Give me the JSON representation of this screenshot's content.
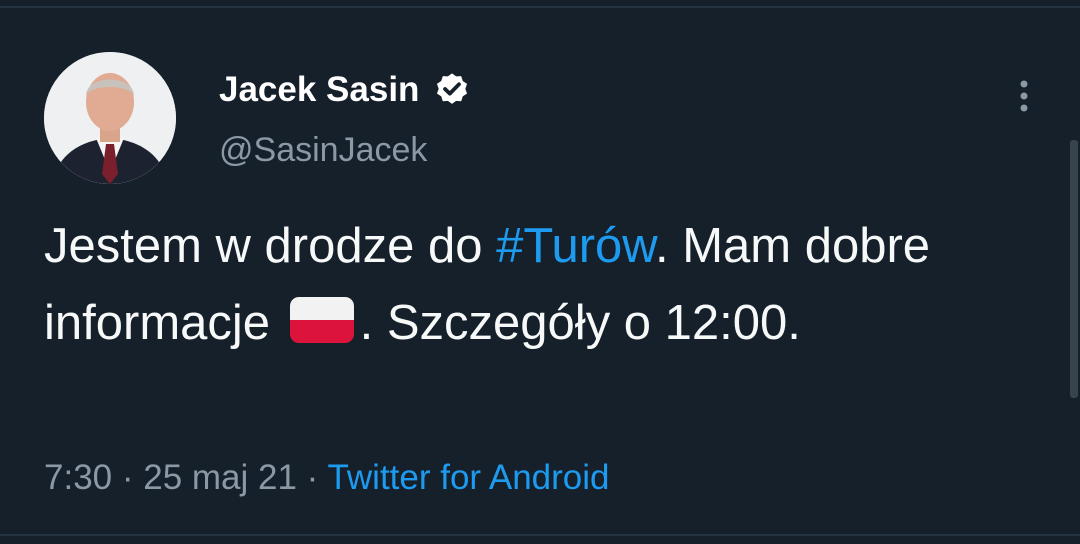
{
  "tweet": {
    "author": {
      "display_name": "Jacek Sasin",
      "handle": "@SasinJacek",
      "verified": true
    },
    "text_parts": {
      "p1": "Jestem w drodze do ",
      "hashtag": "#Turów",
      "p2": ". Mam dobre informacje ",
      "p3": ". Szczegóły o 12:00."
    },
    "emoji": "polish-flag-emoji",
    "meta": {
      "time": "7:30",
      "sep1": " · ",
      "date": "25 maj 21",
      "sep2": " · ",
      "source": "Twitter for Android"
    }
  },
  "icons": {
    "verified": "verified-badge-icon",
    "more": "more-options-icon"
  },
  "colors": {
    "background": "#15202b",
    "text": "#f7f9f9",
    "secondary": "#8b98a5",
    "accent": "#1d9bf0"
  }
}
